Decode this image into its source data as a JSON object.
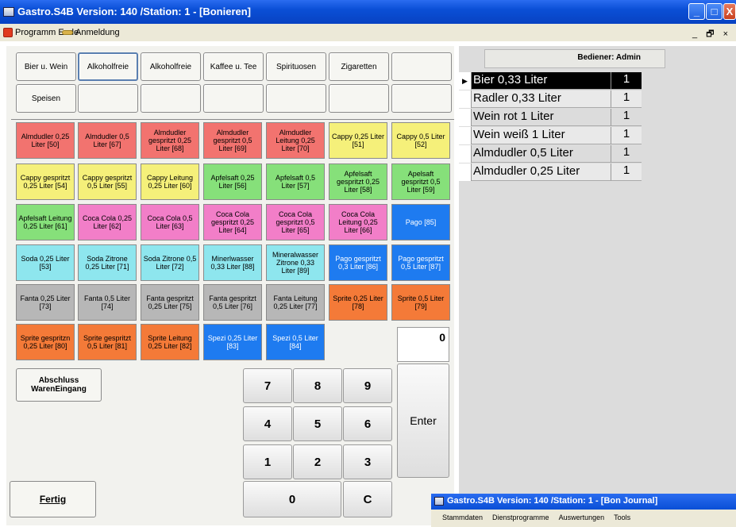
{
  "window": {
    "title": "Gastro.S4B Version:  140 /Station: 1 - [Bonieren]",
    "min": "_",
    "max": "□",
    "close": "X"
  },
  "menu": {
    "exit": "Programm Ende",
    "login": "Anmeldung",
    "mdi_controls": "_ 🗗 ×"
  },
  "categories": [
    {
      "label": "Bier u. Wein",
      "selected": false
    },
    {
      "label": "Alkoholfreie",
      "selected": true
    },
    {
      "label": "Alkoholfreie",
      "selected": false
    },
    {
      "label": "Kaffee u. Tee",
      "selected": false
    },
    {
      "label": "Spirituosen",
      "selected": false
    },
    {
      "label": "Zigaretten",
      "selected": false
    },
    {
      "label": "",
      "selected": false
    },
    {
      "label": "Speisen",
      "selected": false
    },
    {
      "label": "",
      "selected": false
    },
    {
      "label": "",
      "selected": false
    },
    {
      "label": "",
      "selected": false
    },
    {
      "label": "",
      "selected": false
    },
    {
      "label": "",
      "selected": false
    },
    {
      "label": "",
      "selected": false
    }
  ],
  "products": [
    {
      "label": "Almdudler 0,25 Liter [50]",
      "color": "#f2736f"
    },
    {
      "label": "Almdudler 0,5 Liter [67]",
      "color": "#f2736f"
    },
    {
      "label": "Almdudler gespritzt 0,25 Liter [68]",
      "color": "#f2736f"
    },
    {
      "label": "Almdudler gespritzt 0,5 Liter [69]",
      "color": "#f2736f"
    },
    {
      "label": "Almdudler Leitung 0,25 Liter [70]",
      "color": "#f2736f"
    },
    {
      "label": "Cappy 0,25 Liter [51]",
      "color": "#f5f07a"
    },
    {
      "label": "Cappy  0,5 Liter [52]",
      "color": "#f5f07a"
    },
    {
      "label": "Cappy gespritzt 0,25 Liter [54]",
      "color": "#f5f07a"
    },
    {
      "label": "Cappy gespritzt 0,5 Liter [55]",
      "color": "#f5f07a"
    },
    {
      "label": "Cappy Leitung 0,25 Liter [60]",
      "color": "#f5f07a"
    },
    {
      "label": "Apfelsaft 0,25 Liter [56]",
      "color": "#86e07a"
    },
    {
      "label": "Apfelsaft  0,5 Liter [57]",
      "color": "#86e07a"
    },
    {
      "label": "Apfelsaft gespritzt 0,25 Liter [58]",
      "color": "#86e07a"
    },
    {
      "label": "Apelsaft gespritzt 0,5 Liter [59]",
      "color": "#86e07a"
    },
    {
      "label": "Apfelsaft Leitung 0,25 Liter [61]",
      "color": "#86e07a"
    },
    {
      "label": "Coca Cola 0,25 Liter [62]",
      "color": "#f27ec8"
    },
    {
      "label": "Coca Cola 0,5 Liter [63]",
      "color": "#f27ec8"
    },
    {
      "label": "Coca Cola gespritzt 0,25 Liter [64]",
      "color": "#f27ec8"
    },
    {
      "label": "Coca Cola gespritzt 0,5 Liter [65]",
      "color": "#f27ec8"
    },
    {
      "label": "Coca Cola Leitung 0,25 Liter [66]",
      "color": "#f27ec8"
    },
    {
      "label": "Pago [85]",
      "color": "#1e7bf0"
    },
    {
      "label": "Soda  0,25 Liter [53]",
      "color": "#8ee6ee"
    },
    {
      "label": "Soda Zitrone 0,25 Liter [71]",
      "color": "#8ee6ee"
    },
    {
      "label": "Soda Zitrone 0,5 Liter [72]",
      "color": "#8ee6ee"
    },
    {
      "label": "Minerlwasser 0,33 Liter [88]",
      "color": "#8ee6ee"
    },
    {
      "label": "Mineralwasser Zitrone 0,33 Liter [89]",
      "color": "#8ee6ee"
    },
    {
      "label": "Pago gespritzt 0,3 Liter [86]",
      "color": "#1e7bf0"
    },
    {
      "label": "Pago gespritzt 0,5 Liter [87]",
      "color": "#1e7bf0"
    },
    {
      "label": "Fanta 0,25 Liter [73]",
      "color": "#b7b7b7"
    },
    {
      "label": "Fanta 0,5 Liter [74]",
      "color": "#b7b7b7"
    },
    {
      "label": "Fanta gespritzt 0,25 Liter [75]",
      "color": "#b7b7b7"
    },
    {
      "label": "Fanta gespritzt 0,5 Liter [76]",
      "color": "#b7b7b7"
    },
    {
      "label": "Fanta Leitung 0,25 Liter [77]",
      "color": "#b7b7b7"
    },
    {
      "label": "Sprite 0,25 Liter [78]",
      "color": "#f47a38"
    },
    {
      "label": "Sprite 0,5 Liter [79]",
      "color": "#f47a38"
    },
    {
      "label": "Sprite gespritzn 0,25 Liter [80]",
      "color": "#f47a38"
    },
    {
      "label": "Sprite gespritzt 0,5 Liter [81]",
      "color": "#f47a38"
    },
    {
      "label": "Sprite Leitung 0,25 Liter [82]",
      "color": "#f47a38"
    },
    {
      "label": "Spezi 0,25 Liter [83]",
      "color": "#1e7bf0"
    },
    {
      "label": "Spezi 0,5 Liter [84]",
      "color": "#1e7bf0"
    }
  ],
  "actions": {
    "abschluss": "Abschluss WarenEingang",
    "fertig": "Fertig"
  },
  "keypad": {
    "keys": [
      "7",
      "8",
      "9",
      "4",
      "5",
      "6",
      "1",
      "2",
      "3"
    ],
    "zero": "0",
    "clear": "C",
    "enter": "Enter",
    "display": "0"
  },
  "operator": "Bediener: Admin",
  "order": [
    {
      "name": "Bier 0,33 Liter",
      "qty": "1"
    },
    {
      "name": "Radler 0,33 Liter",
      "qty": "1"
    },
    {
      "name": "Wein rot 1 Liter",
      "qty": "1"
    },
    {
      "name": "Wein weiß 1 Liter",
      "qty": "1"
    },
    {
      "name": "Almdudler 0,5 Liter",
      "qty": "1"
    },
    {
      "name": "Almdudler 0,25 Liter",
      "qty": "1"
    }
  ],
  "journal": {
    "title": "Gastro.S4B Version:  140 /Station: 1 - [Bon Journal]",
    "menu": [
      "Stammdaten",
      "Dienstprogramme",
      "Auswertungen",
      "Tools"
    ]
  }
}
